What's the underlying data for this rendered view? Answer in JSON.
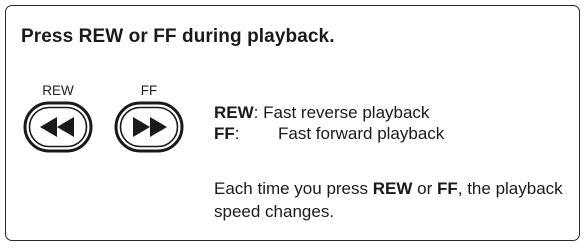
{
  "heading": "Press REW or FF during playback.",
  "buttons": {
    "rew": {
      "label": "REW",
      "icon": "rewind-icon"
    },
    "ff": {
      "label": "FF",
      "icon": "fast-forward-icon"
    }
  },
  "descriptions": [
    {
      "term": "REW",
      "separator": ":",
      "text": "Fast reverse playback"
    },
    {
      "term": "FF",
      "separator": ":",
      "text": "Fast forward playback"
    }
  ],
  "note": {
    "prefix": "Each time you press ",
    "key1": "REW",
    "middle": " or ",
    "key2": "FF",
    "suffix": ", the playback speed changes."
  },
  "colors": {
    "border": "#2a2a2a",
    "text": "#1a1a1a"
  }
}
